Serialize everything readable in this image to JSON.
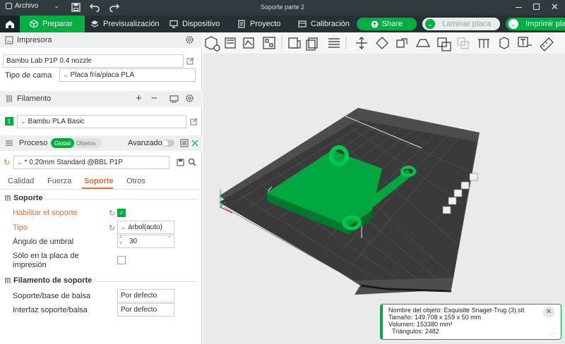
{
  "titlebar": {
    "menu_label": "Archivo",
    "window_title": "Soporte parte 2"
  },
  "tabs": {
    "prepare": "Preparar",
    "preview": "Previsualización",
    "device": "Dispositivo",
    "project": "Proyecto",
    "calibration": "Calibración",
    "share": "Share",
    "slice": "Laminar placa",
    "print": "Imprimir pla"
  },
  "printer": {
    "section_title": "Impresora",
    "printer_name": "Bambu Lab P1P 0.4 nozzle",
    "bed_type_label": "Tipo de cama",
    "bed_type_value": "Placa fría/placa PLA"
  },
  "filament": {
    "section_title": "Filamento",
    "slot_number": "1",
    "filament_name": "Bambu PLA Basic"
  },
  "process": {
    "section_title": "Proceso",
    "toggle_global": "Global",
    "toggle_objects": "Objetos",
    "advanced_label": "Avanzado",
    "profile": "* 0.20mm Standard @BBL P1P",
    "subtabs": [
      "Calidad",
      "Fuerza",
      "Soporte",
      "Otros"
    ]
  },
  "support": {
    "group_title": "Soporte",
    "enable_label": "Habilitar el soporte",
    "type_label": "Tipo",
    "type_value": "árbol(auto)",
    "threshold_label": "Ángulo de umbral",
    "threshold_value": "30",
    "threshold_unit": "°",
    "on_plate_label": "Sólo en la placa de impresión",
    "filament_group_title": "Filamento de soporte",
    "base_label": "Soporte/base de balsa",
    "base_value": "Por defecto",
    "interface_label": "Interfaz soporte/balsa",
    "interface_value": "Por defecto"
  },
  "object_info": {
    "name_line": "Nombre del objeto: Exquisite Snaget-Trug (3).stl",
    "size_line": "Tamaño: 149.708 x 159 x 50 mm",
    "volume_line": "Volumen: 153380 mm³",
    "triangles_line": "Triángulos: 2482"
  },
  "colors": {
    "accent": "#00ae42",
    "warning_label": "#e26e38",
    "titlebar": "#303b40",
    "tabbar": "#263034"
  },
  "icons": [
    "home-icon",
    "save-icon",
    "undo-icon",
    "redo-icon",
    "gear-icon",
    "edit-icon",
    "add-icon",
    "remove-icon",
    "sync-icon",
    "search-icon",
    "reset-icon",
    "close-icon"
  ]
}
